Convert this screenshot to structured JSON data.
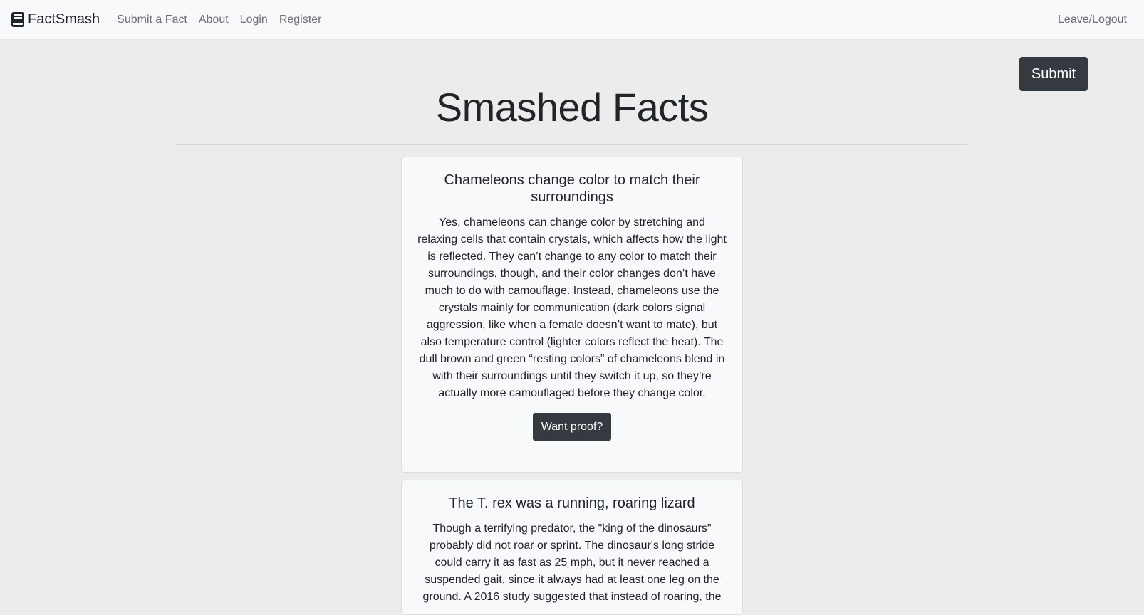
{
  "navbar": {
    "brand": "FactSmash",
    "brand_icon": "book-icon",
    "links": [
      "Submit a Fact",
      "About",
      "Login",
      "Register"
    ],
    "right_link": "Leave/Logout"
  },
  "submit_button": "Submit",
  "page_title": "Smashed Facts",
  "facts": [
    {
      "title": "Chameleons change color to match their surroundings",
      "body": "Yes, chameleons can change color by stretching and relaxing cells that contain crystals, which affects how the light is reflected. They can’t change to any color to match their surroundings, though, and their color changes don’t have much to do with camouflage. Instead, chameleons use the crystals mainly for communication (dark colors signal aggression, like when a female doesn’t want to mate), but also temperature control (lighter colors reflect the heat). The dull brown and green “resting colors” of chameleons blend in with their surroundings until they switch it up, so they’re actually more camouflaged before they change color.",
      "button": "Want proof?"
    },
    {
      "title": "The T. rex was a running, roaring lizard",
      "body": "Though a terrifying predator, the \"king of the dinosaurs\" probably did not roar or sprint. The dinosaur's long stride could carry it as fast as 25 mph, but it never reached a suspended gait, since it always had at least one leg on the ground. A 2016 study suggested that instead of roaring, the"
    }
  ]
}
